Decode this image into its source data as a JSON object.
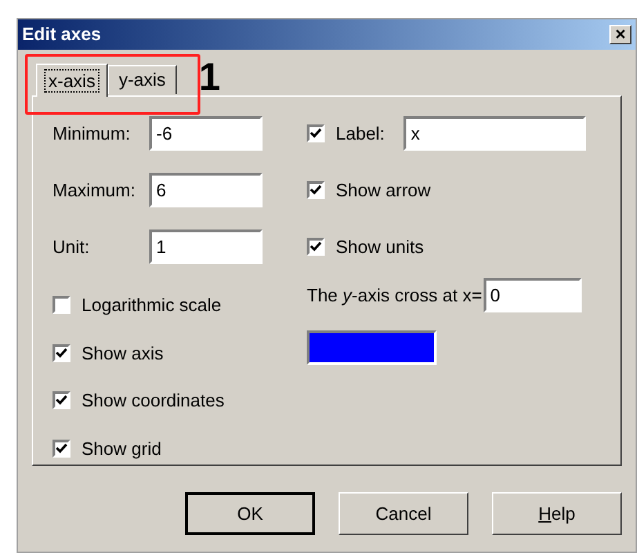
{
  "window": {
    "title": "Edit axes",
    "close": "×"
  },
  "tabs": [
    {
      "label": "x-axis",
      "selected": true
    },
    {
      "label": "y-axis",
      "selected": false
    }
  ],
  "annotation": {
    "label": "1"
  },
  "fields": [
    {
      "label": "Minimum:",
      "value": "-6"
    },
    {
      "label": "Maximum:",
      "value": "6"
    },
    {
      "label": "Unit:",
      "value": "1"
    }
  ],
  "right_options": [
    {
      "kind": "checkfield",
      "label": "Label:",
      "checked": true,
      "value": "x"
    },
    {
      "kind": "check",
      "label": "Show arrow",
      "checked": true
    },
    {
      "kind": "check",
      "label": "Show units",
      "checked": true
    }
  ],
  "left_options": [
    {
      "label": "Logarithmic scale",
      "checked": false
    },
    {
      "label": "Show axis",
      "checked": true
    },
    {
      "label": "Show coordinates",
      "checked": true
    },
    {
      "label": "Show grid",
      "checked": true
    }
  ],
  "cross": {
    "label": "The *y*-axis cross at x=",
    "value": "0"
  },
  "axis_color": {
    "color": "#0000ff"
  },
  "buttons": [
    {
      "label": "OK",
      "default": true,
      "underline_first": false
    },
    {
      "label": "Cancel",
      "default": false,
      "underline_first": false
    },
    {
      "label": "Help",
      "default": false,
      "underline_first": true
    }
  ]
}
